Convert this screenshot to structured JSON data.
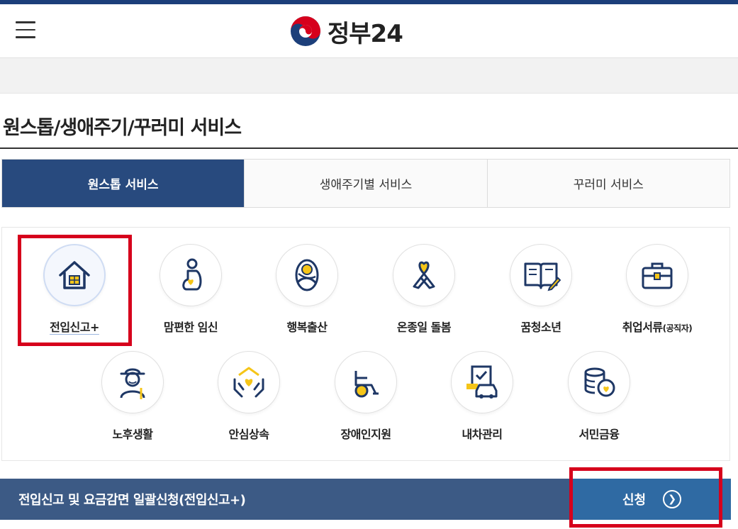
{
  "header": {
    "logo_text": "정부24",
    "menu_icon": "hamburger-icon"
  },
  "page": {
    "title": "원스톱/생애주기/꾸러미 서비스"
  },
  "tabs": [
    {
      "label": "원스톱 서비스",
      "active": true
    },
    {
      "label": "생애주기별 서비스",
      "active": false
    },
    {
      "label": "꾸러미 서비스",
      "active": false
    }
  ],
  "services": [
    {
      "label": "전입신고+",
      "icon": "house-icon",
      "selected": true
    },
    {
      "label": "맘편한 임신",
      "icon": "pregnant-woman-icon"
    },
    {
      "label": "행복출산",
      "icon": "baby-icon"
    },
    {
      "label": "온종일 돌봄",
      "icon": "ribbon-heart-icon"
    },
    {
      "label": "꿈청소년",
      "icon": "book-pen-icon"
    },
    {
      "label": "취업서류",
      "label_small": "(공직자)",
      "icon": "briefcase-icon"
    },
    {
      "label": "노후생활",
      "icon": "elderly-man-icon"
    },
    {
      "label": "안심상속",
      "icon": "hands-heart-icon"
    },
    {
      "label": "장애인지원",
      "icon": "wheelchair-icon"
    },
    {
      "label": "내차관리",
      "icon": "car-document-icon"
    },
    {
      "label": "서민금융",
      "icon": "coins-icon"
    }
  ],
  "apply_bar": {
    "text": "전입신고 및 요금감면 일괄신청(전입신고+)",
    "button_label": "신청",
    "button_icon": "chevron-right-circle-icon"
  },
  "colors": {
    "brand_navy": "#284a7e",
    "apply_bar": "#3c5a85",
    "apply_button": "#2f6aa3",
    "highlight_red": "#d6001c",
    "icon_navy": "#1e3765",
    "icon_yellow": "#f5c518"
  }
}
